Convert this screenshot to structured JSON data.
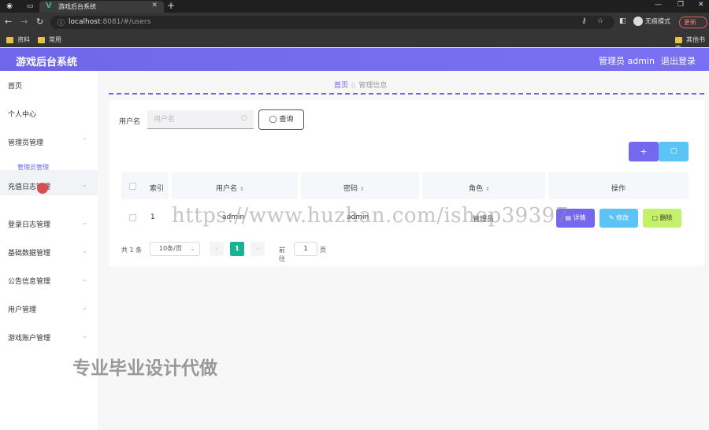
{
  "browser": {
    "tab_title": "游戏后台系统",
    "url_host": "localhost",
    "url_rest": ":8081/#/users",
    "incognito_label": "无痕模式",
    "update_label": "更新",
    "bookmarks": [
      "资料",
      "常用"
    ],
    "other_bookmarks": "其他书签"
  },
  "header": {
    "title": "游戏后台系统",
    "admin_label": "管理员 admin",
    "logout_label": "退出登录"
  },
  "sidebar": {
    "items": [
      "首页",
      "个人中心",
      "管理员管理",
      "充值日志管理",
      "登录日志管理",
      "基础数据管理",
      "公告信息管理",
      "用户管理",
      "游戏账户管理"
    ],
    "submenu": "管理员管理"
  },
  "breadcrumb": {
    "home": "首页",
    "current": "管理信息"
  },
  "search": {
    "label": "用户名",
    "placeholder": "用户名",
    "query_label": "查询"
  },
  "table": {
    "columns": [
      "索引",
      "用户名",
      "密码",
      "角色",
      "操作"
    ],
    "rows": [
      {
        "index": "1",
        "username": "admin",
        "password": "admin",
        "role": "管理员"
      }
    ],
    "actions": {
      "detail": "详情",
      "edit": "修改",
      "delete": "删除"
    }
  },
  "pager": {
    "total": "共 1 条",
    "page_size": "10条/页",
    "current_page": "1",
    "goto_label": "前往",
    "goto_value": "1",
    "goto_suffix": "页"
  },
  "watermarks": {
    "url": "https://www.huzhan.com/ishop39397",
    "text": "专业毕业设计代做"
  },
  "colors": {
    "accent": "#7367f0",
    "detail": "#7468ef",
    "edit": "#5bc3f5",
    "delete": "#c4f06a",
    "page_active": "#19b394"
  }
}
